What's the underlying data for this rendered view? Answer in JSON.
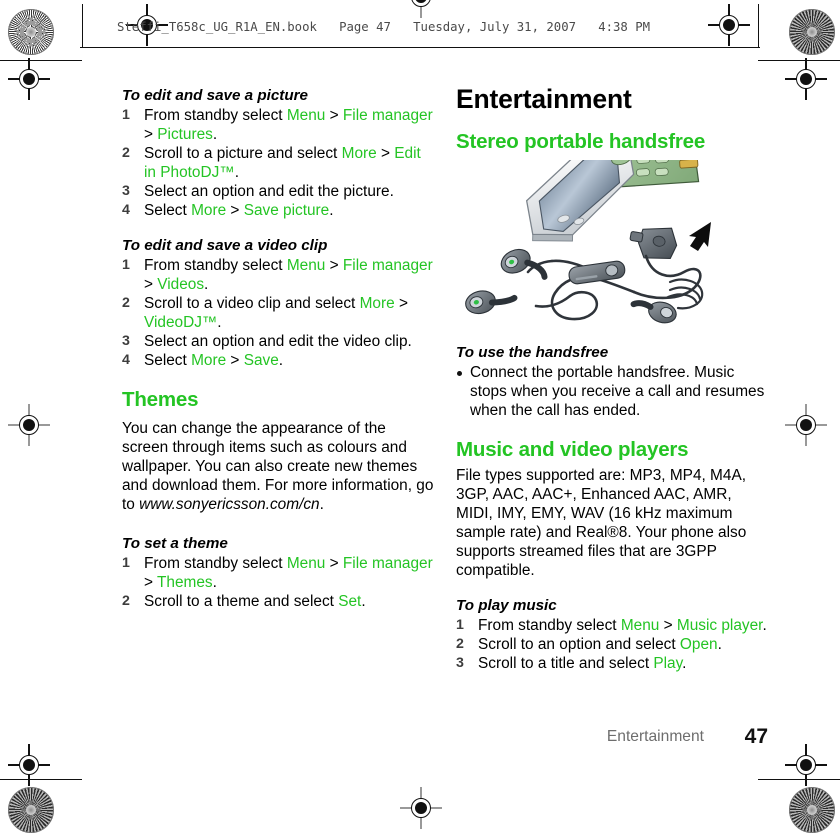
{
  "header": {
    "book_line": "Steffi_T658c_UG_R1A_EN.book   Page 47   Tuesday, July 31, 2007   4:38 PM"
  },
  "colors": {
    "accent_green": "#24c424",
    "body_text": "#000000",
    "footer_gray": "#6d6d6d",
    "header_gray": "#4a4a4a"
  },
  "left_column": {
    "proc1": {
      "title": "To edit and save a picture",
      "steps": [
        {
          "num": "1",
          "parts": [
            {
              "t": "From standby select ",
              "s": "plain"
            },
            {
              "t": "Menu",
              "s": "green"
            },
            {
              "t": " > ",
              "s": "plain"
            },
            {
              "t": "File manager",
              "s": "green"
            },
            {
              "t": " > ",
              "s": "plain"
            },
            {
              "t": "Pictures",
              "s": "green"
            },
            {
              "t": ".",
              "s": "plain"
            }
          ]
        },
        {
          "num": "2",
          "parts": [
            {
              "t": "Scroll to a picture and select ",
              "s": "plain"
            },
            {
              "t": "More",
              "s": "green"
            },
            {
              "t": " > ",
              "s": "plain"
            },
            {
              "t": "Edit in PhotoDJ™",
              "s": "green"
            },
            {
              "t": ".",
              "s": "plain"
            }
          ]
        },
        {
          "num": "3",
          "parts": [
            {
              "t": "Select an option and edit the picture.",
              "s": "plain"
            }
          ]
        },
        {
          "num": "4",
          "parts": [
            {
              "t": "Select ",
              "s": "plain"
            },
            {
              "t": "More",
              "s": "green"
            },
            {
              "t": " > ",
              "s": "plain"
            },
            {
              "t": "Save picture",
              "s": "green"
            },
            {
              "t": ".",
              "s": "plain"
            }
          ]
        }
      ]
    },
    "proc2": {
      "title": "To edit and save a video clip",
      "steps": [
        {
          "num": "1",
          "parts": [
            {
              "t": "From standby select ",
              "s": "plain"
            },
            {
              "t": "Menu",
              "s": "green"
            },
            {
              "t": " > ",
              "s": "plain"
            },
            {
              "t": "File manager",
              "s": "green"
            },
            {
              "t": " > ",
              "s": "plain"
            },
            {
              "t": "Videos",
              "s": "green"
            },
            {
              "t": ".",
              "s": "plain"
            }
          ]
        },
        {
          "num": "2",
          "parts": [
            {
              "t": "Scroll to a video clip and select ",
              "s": "plain"
            },
            {
              "t": "More",
              "s": "green"
            },
            {
              "t": " > ",
              "s": "plain"
            },
            {
              "t": "VideoDJ™",
              "s": "green"
            },
            {
              "t": ".",
              "s": "plain"
            }
          ]
        },
        {
          "num": "3",
          "parts": [
            {
              "t": "Select an option and edit the video clip.",
              "s": "plain"
            }
          ]
        },
        {
          "num": "4",
          "parts": [
            {
              "t": "Select ",
              "s": "plain"
            },
            {
              "t": "More",
              "s": "green"
            },
            {
              "t": " > ",
              "s": "plain"
            },
            {
              "t": "Save",
              "s": "green"
            },
            {
              "t": ".",
              "s": "plain"
            }
          ]
        }
      ]
    },
    "themes": {
      "heading": "Themes",
      "body_parts": [
        {
          "t": "You can change the appearance of the screen through items such as colours and wallpaper. You can also create new themes and download them. For more information, go to ",
          "s": "plain"
        },
        {
          "t": "www.sonyericsson.com/cn",
          "s": "italic"
        },
        {
          "t": ".",
          "s": "plain"
        }
      ]
    },
    "proc3": {
      "title": "To set a theme",
      "steps": [
        {
          "num": "1",
          "parts": [
            {
              "t": "From standby select ",
              "s": "plain"
            },
            {
              "t": "Menu",
              "s": "green"
            },
            {
              "t": " > ",
              "s": "plain"
            },
            {
              "t": "File manager",
              "s": "green"
            },
            {
              "t": " > ",
              "s": "plain"
            },
            {
              "t": "Themes",
              "s": "green"
            },
            {
              "t": ".",
              "s": "plain"
            }
          ]
        },
        {
          "num": "2",
          "parts": [
            {
              "t": "Scroll to a theme and select ",
              "s": "plain"
            },
            {
              "t": "Set",
              "s": "green"
            },
            {
              "t": ".",
              "s": "plain"
            }
          ]
        }
      ]
    }
  },
  "right_column": {
    "chapter_title": "Entertainment",
    "section1": {
      "heading": "Stereo portable handsfree",
      "illustration_alt": "mobile-phone-with-stereo-handsfree-headset",
      "proc": {
        "title": "To use the handsfree",
        "bullets": [
          "Connect the portable handsfree. Music stops when you receive a call and resumes when the call has ended."
        ]
      }
    },
    "section2": {
      "heading": "Music and video players",
      "body_parts": [
        {
          "t": "File types supported are: MP3, MP4, M4A, 3GP, AAC, AAC+, Enhanced AAC, AMR, MIDI, IMY, EMY, WAV (16 kHz maximum sample rate) and Real®8. Your phone also supports streamed files that are 3GPP compatible.",
          "s": "plain"
        }
      ],
      "proc": {
        "title": "To play music",
        "steps": [
          {
            "num": "1",
            "parts": [
              {
                "t": "From standby select ",
                "s": "plain"
              },
              {
                "t": "Menu",
                "s": "green"
              },
              {
                "t": " > ",
                "s": "plain"
              },
              {
                "t": "Music player",
                "s": "green"
              },
              {
                "t": ".",
                "s": "plain"
              }
            ]
          },
          {
            "num": "2",
            "parts": [
              {
                "t": "Scroll to an option and select ",
                "s": "plain"
              },
              {
                "t": "Open",
                "s": "green"
              },
              {
                "t": ".",
                "s": "plain"
              }
            ]
          },
          {
            "num": "3",
            "parts": [
              {
                "t": "Scroll to a title and select ",
                "s": "plain"
              },
              {
                "t": "Play",
                "s": "green"
              },
              {
                "t": ".",
                "s": "plain"
              }
            ]
          }
        ]
      }
    }
  },
  "footer": {
    "chapter_name": "Entertainment",
    "page_number": "47"
  }
}
